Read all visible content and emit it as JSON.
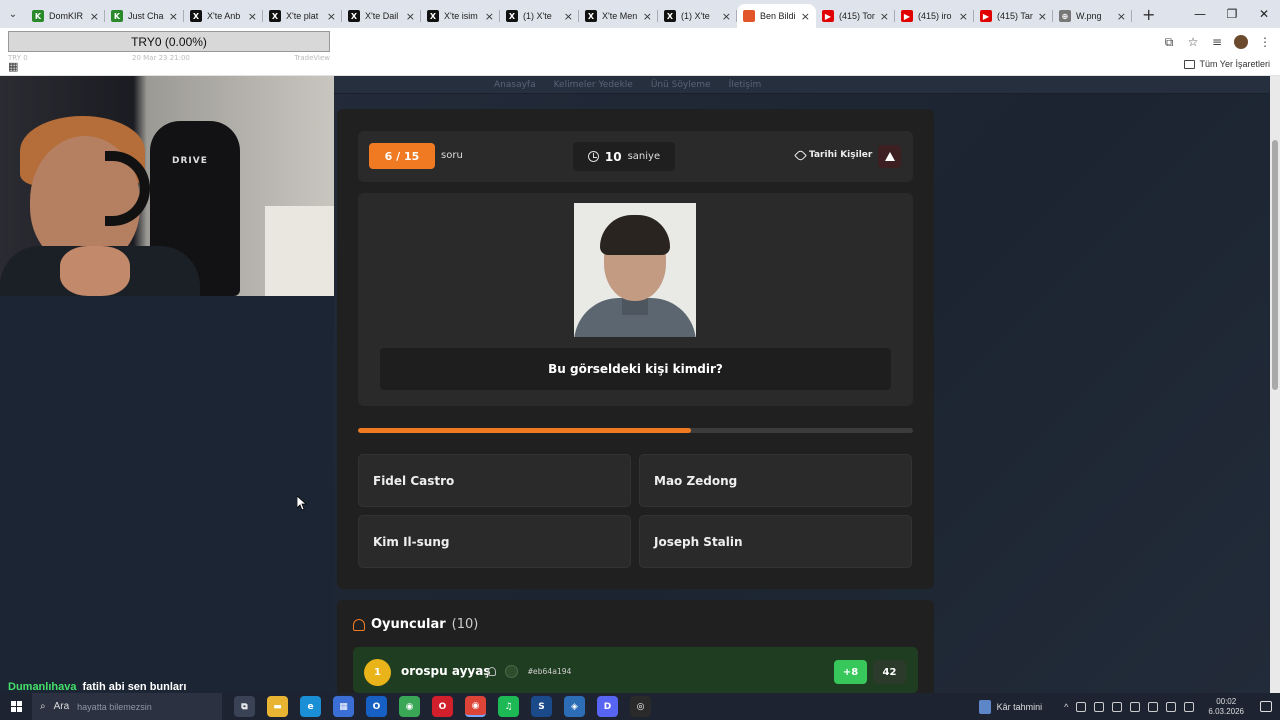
{
  "browser": {
    "tabs": [
      {
        "title": "DomKIR",
        "fav_color": "#2a8a2a",
        "fav_text": "K",
        "active": false
      },
      {
        "title": "Just Cha",
        "fav_color": "#2a8a2a",
        "fav_text": "K",
        "active": false
      },
      {
        "title": "X'te Anb",
        "fav_color": "#111111",
        "fav_text": "X",
        "active": false
      },
      {
        "title": "X'te plat",
        "fav_color": "#111111",
        "fav_text": "X",
        "active": false
      },
      {
        "title": "X'te Dail",
        "fav_color": "#111111",
        "fav_text": "X",
        "active": false
      },
      {
        "title": "X'te isim",
        "fav_color": "#111111",
        "fav_text": "X",
        "active": false
      },
      {
        "title": "(1) X'te",
        "fav_color": "#111111",
        "fav_text": "X",
        "active": false
      },
      {
        "title": "X'te Men",
        "fav_color": "#111111",
        "fav_text": "X",
        "active": false
      },
      {
        "title": "(1) X'te",
        "fav_color": "#111111",
        "fav_text": "X",
        "active": false
      },
      {
        "title": "Ben Bildi",
        "fav_color": "#e2552a",
        "fav_text": "",
        "active": true
      },
      {
        "title": "(415) Tor",
        "fav_color": "#e00000",
        "fav_text": "▶",
        "active": false
      },
      {
        "title": "(415) iro",
        "fav_color": "#e00000",
        "fav_text": "▶",
        "active": false
      },
      {
        "title": "(415) Tar",
        "fav_color": "#e00000",
        "fav_text": "▶",
        "active": false
      },
      {
        "title": "W.png",
        "fav_color": "#777777",
        "fav_text": "⊕",
        "active": false
      }
    ],
    "new_tab": "+",
    "window_controls": [
      "—",
      "❐",
      "✕"
    ],
    "bookmarks_label": "Tüm Yer İşaretleri"
  },
  "overlay": {
    "ticker": "TRY0 (0.00%)",
    "ticker_sub_left": "TRY 0",
    "ticker_sub_mid": "20 Mar 23 21:00",
    "ticker_sub_right": "TradeView"
  },
  "webcam": {
    "chair_brand": "DRIVE"
  },
  "site_nav": [
    "Anasayfa",
    "Kelimeler Yedekle",
    "Ünü Söyleme",
    "İletişim"
  ],
  "quiz": {
    "counter": "6 / 15",
    "counter_label": "soru",
    "timer_value": "10",
    "timer_unit": "saniye",
    "category": "Tarihi Kişiler",
    "question": "Bu görseldeki kişi kimdir?",
    "progress": 0.6,
    "answers": [
      "Fidel Castro",
      "Mao Zedong",
      "Kim Il-sung",
      "Joseph Stalin"
    ]
  },
  "players": {
    "title": "Oyuncular",
    "count": "(10)",
    "rows": [
      {
        "rank": "1",
        "name": "orospu ayyaş",
        "tag": "#eb64a194",
        "plus": "+8",
        "score": "42"
      }
    ]
  },
  "chat": {
    "user": "Dumanlıhava",
    "message": "fatih abi sen bunları"
  },
  "taskbar": {
    "search_label": "Ara",
    "search_hint": "hayatta bilemezsin",
    "weather": "Kâr tahmini",
    "time": "00:02",
    "date": "6.03.2026",
    "apps": [
      {
        "name": "task-view",
        "color": "#3a4256",
        "text": "⧉"
      },
      {
        "name": "file-explorer",
        "color": "#e8b432",
        "text": "▬"
      },
      {
        "name": "edge",
        "color": "#1b8fd6",
        "text": "e"
      },
      {
        "name": "store",
        "color": "#3b6fd6",
        "text": "▦"
      },
      {
        "name": "outlook",
        "color": "#1660c4",
        "text": "O"
      },
      {
        "name": "chrome",
        "color": "#3aa757",
        "text": "◉"
      },
      {
        "name": "opera",
        "color": "#d21f2c",
        "text": "O"
      },
      {
        "name": "chrome-active",
        "color": "#db4437",
        "text": "◉"
      },
      {
        "name": "spotify",
        "color": "#1db954",
        "text": "♫"
      },
      {
        "name": "steam",
        "color": "#1b4a8a",
        "text": "S"
      },
      {
        "name": "app-blue",
        "color": "#2c6db5",
        "text": "◈"
      },
      {
        "name": "discord",
        "color": "#5865f2",
        "text": "D"
      },
      {
        "name": "obs",
        "color": "#2a2a2a",
        "text": "◎"
      }
    ]
  }
}
